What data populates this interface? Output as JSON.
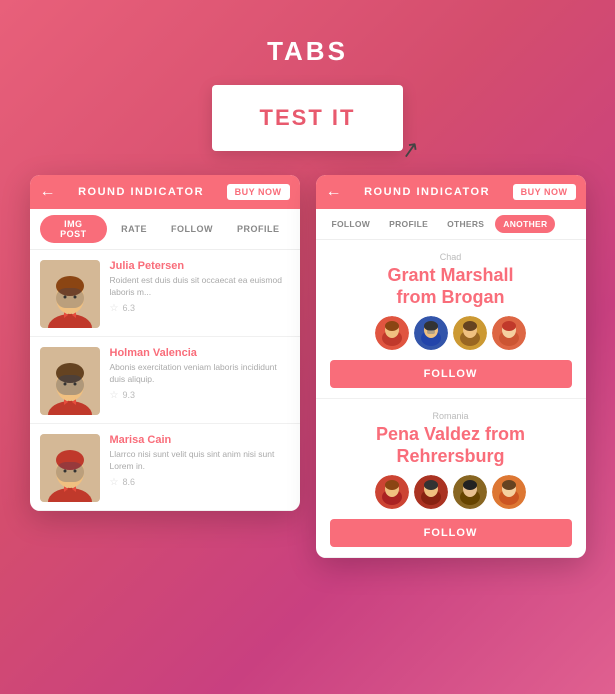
{
  "page": {
    "title": "TABS",
    "test_button": "TEST IT"
  },
  "card1": {
    "topbar": {
      "back": "←",
      "title": "ROUND INDICATOR",
      "buy_label": "BUY NOW"
    },
    "tabs": [
      {
        "label": "IMG POST",
        "active": true
      },
      {
        "label": "RATE",
        "active": false
      },
      {
        "label": "FOLLOW",
        "active": false
      },
      {
        "label": "PROFILE",
        "active": false
      }
    ],
    "profiles": [
      {
        "name": "Julia Petersen",
        "desc": "Roident est duis duis sit occaecat ea euismod laboris m...",
        "rating": "6.3",
        "avatar_color": "#e8c89a"
      },
      {
        "name": "Holman Valencia",
        "desc": "Abonis exercitation veniam laboris incididunt duis aliquip.",
        "rating": "9.3",
        "avatar_color": "#e8c89a"
      },
      {
        "name": "Marisa Cain",
        "desc": "Llarrco nisi sunt velit quis sint anim nisi sunt Lorem in.",
        "rating": "8.6",
        "avatar_color": "#e8c89a"
      }
    ]
  },
  "card2": {
    "topbar": {
      "back": "←",
      "title": "ROUND INDICATOR",
      "buy_label": "BUY NOW"
    },
    "tabs": [
      {
        "label": "FOLLOW",
        "active": false
      },
      {
        "label": "PROFILE",
        "active": false
      },
      {
        "label": "OTHERS",
        "active": false
      },
      {
        "label": "ANOTHER",
        "active": true
      }
    ],
    "users": [
      {
        "country": "Chad",
        "name": "Grant Marshall\nfrom Brogan",
        "name_line1": "Grant Marshall",
        "name_line2": "from Brogan",
        "follow_label": "FOLLOW",
        "avatars": [
          "#e05540",
          "#3355aa",
          "#cc9933",
          "#dd6644"
        ]
      },
      {
        "country": "Romania",
        "name": "Pena Valdez from\nRehrersburg",
        "name_line1": "Pena Valdez from",
        "name_line2": "Rehrersburg",
        "follow_label": "FOLLOW",
        "avatars": [
          "#cc4433",
          "#aa3322",
          "#886622",
          "#dd7733"
        ]
      }
    ]
  }
}
